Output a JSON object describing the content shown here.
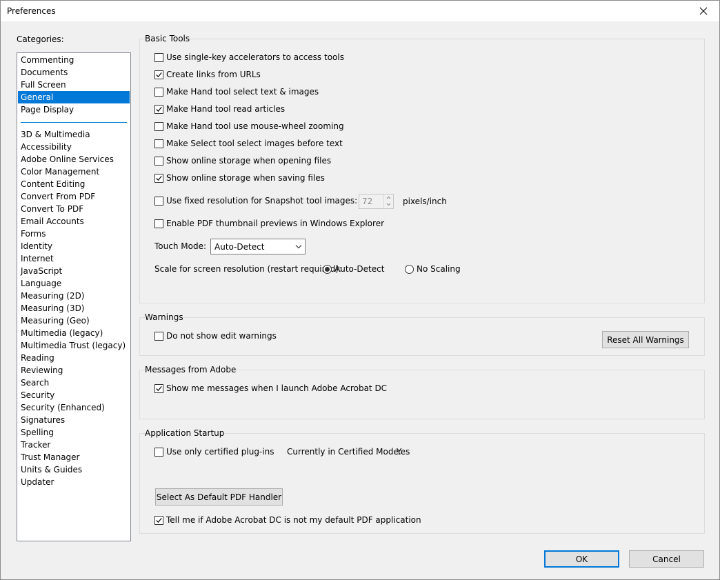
{
  "window": {
    "title": "Preferences"
  },
  "sidebar": {
    "label": "Categories:",
    "top_items": [
      "Commenting",
      "Documents",
      "Full Screen",
      "General",
      "Page Display"
    ],
    "selected": "General",
    "items": [
      "3D & Multimedia",
      "Accessibility",
      "Adobe Online Services",
      "Color Management",
      "Content Editing",
      "Convert From PDF",
      "Convert To PDF",
      "Email Accounts",
      "Forms",
      "Identity",
      "Internet",
      "JavaScript",
      "Language",
      "Measuring (2D)",
      "Measuring (3D)",
      "Measuring (Geo)",
      "Multimedia (legacy)",
      "Multimedia Trust (legacy)",
      "Reading",
      "Reviewing",
      "Search",
      "Security",
      "Security (Enhanced)",
      "Signatures",
      "Spelling",
      "Tracker",
      "Trust Manager",
      "Units & Guides",
      "Updater"
    ]
  },
  "basic_tools": {
    "title": "Basic Tools",
    "options": [
      {
        "label": "Use single-key accelerators to access tools",
        "checked": false
      },
      {
        "label": "Create links from URLs",
        "checked": true
      },
      {
        "label": "Make Hand tool select text & images",
        "checked": false
      },
      {
        "label": "Make Hand tool read articles",
        "checked": true
      },
      {
        "label": "Make Hand tool use mouse-wheel zooming",
        "checked": false
      },
      {
        "label": "Make Select tool select images before text",
        "checked": false
      },
      {
        "label": "Show online storage when opening files",
        "checked": false
      },
      {
        "label": "Show online storage when saving files",
        "checked": true
      }
    ],
    "fixed_resolution_label": "Use fixed resolution for Snapshot tool images:",
    "fixed_resolution_checked": false,
    "resolution_value": "72",
    "resolution_unit": "pixels/inch",
    "thumbnail_label": "Enable PDF thumbnail previews in Windows Explorer",
    "thumbnail_checked": false,
    "touch_mode_label": "Touch Mode:",
    "touch_mode_value": "Auto-Detect",
    "scale_label": "Scale for screen resolution (restart required):",
    "scale_options": [
      "Auto-Detect",
      "No Scaling"
    ],
    "scale_selected": "Auto-Detect"
  },
  "warnings": {
    "title": "Warnings",
    "option_label": "Do not show edit warnings",
    "option_checked": false,
    "reset_button": "Reset All Warnings"
  },
  "messages": {
    "title": "Messages from Adobe",
    "option_label": "Show me messages when I launch Adobe Acrobat DC",
    "option_checked": true
  },
  "startup": {
    "title": "Application Startup",
    "certified_label": "Use only certified plug-ins",
    "certified_checked": false,
    "mode_label": "Currently in Certified Mode:",
    "mode_value": "Yes",
    "default_handler_button": "Select As Default PDF Handler",
    "tell_me_label": "Tell me if Adobe Acrobat DC is not my default PDF application",
    "tell_me_checked": true
  },
  "footer": {
    "ok": "OK",
    "cancel": "Cancel"
  },
  "colors": {
    "accent": "#0078d7",
    "selection_text": "#ffffff"
  }
}
